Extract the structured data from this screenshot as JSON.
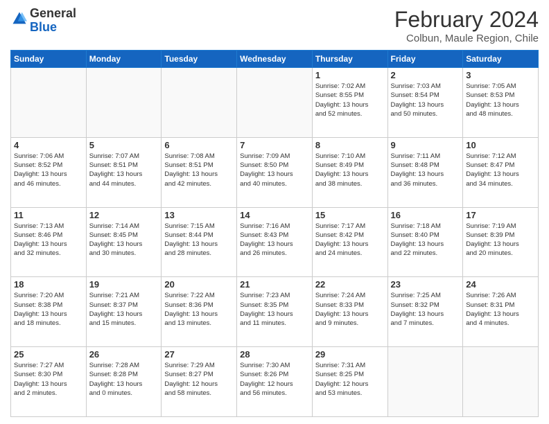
{
  "header": {
    "logo": {
      "line1": "General",
      "line2": "Blue"
    },
    "title": "February 2024",
    "subtitle": "Colbun, Maule Region, Chile"
  },
  "calendar": {
    "days_of_week": [
      "Sunday",
      "Monday",
      "Tuesday",
      "Wednesday",
      "Thursday",
      "Friday",
      "Saturday"
    ],
    "weeks": [
      [
        {
          "day": "",
          "info": ""
        },
        {
          "day": "",
          "info": ""
        },
        {
          "day": "",
          "info": ""
        },
        {
          "day": "",
          "info": ""
        },
        {
          "day": "1",
          "info": "Sunrise: 7:02 AM\nSunset: 8:55 PM\nDaylight: 13 hours\nand 52 minutes."
        },
        {
          "day": "2",
          "info": "Sunrise: 7:03 AM\nSunset: 8:54 PM\nDaylight: 13 hours\nand 50 minutes."
        },
        {
          "day": "3",
          "info": "Sunrise: 7:05 AM\nSunset: 8:53 PM\nDaylight: 13 hours\nand 48 minutes."
        }
      ],
      [
        {
          "day": "4",
          "info": "Sunrise: 7:06 AM\nSunset: 8:52 PM\nDaylight: 13 hours\nand 46 minutes."
        },
        {
          "day": "5",
          "info": "Sunrise: 7:07 AM\nSunset: 8:51 PM\nDaylight: 13 hours\nand 44 minutes."
        },
        {
          "day": "6",
          "info": "Sunrise: 7:08 AM\nSunset: 8:51 PM\nDaylight: 13 hours\nand 42 minutes."
        },
        {
          "day": "7",
          "info": "Sunrise: 7:09 AM\nSunset: 8:50 PM\nDaylight: 13 hours\nand 40 minutes."
        },
        {
          "day": "8",
          "info": "Sunrise: 7:10 AM\nSunset: 8:49 PM\nDaylight: 13 hours\nand 38 minutes."
        },
        {
          "day": "9",
          "info": "Sunrise: 7:11 AM\nSunset: 8:48 PM\nDaylight: 13 hours\nand 36 minutes."
        },
        {
          "day": "10",
          "info": "Sunrise: 7:12 AM\nSunset: 8:47 PM\nDaylight: 13 hours\nand 34 minutes."
        }
      ],
      [
        {
          "day": "11",
          "info": "Sunrise: 7:13 AM\nSunset: 8:46 PM\nDaylight: 13 hours\nand 32 minutes."
        },
        {
          "day": "12",
          "info": "Sunrise: 7:14 AM\nSunset: 8:45 PM\nDaylight: 13 hours\nand 30 minutes."
        },
        {
          "day": "13",
          "info": "Sunrise: 7:15 AM\nSunset: 8:44 PM\nDaylight: 13 hours\nand 28 minutes."
        },
        {
          "day": "14",
          "info": "Sunrise: 7:16 AM\nSunset: 8:43 PM\nDaylight: 13 hours\nand 26 minutes."
        },
        {
          "day": "15",
          "info": "Sunrise: 7:17 AM\nSunset: 8:42 PM\nDaylight: 13 hours\nand 24 minutes."
        },
        {
          "day": "16",
          "info": "Sunrise: 7:18 AM\nSunset: 8:40 PM\nDaylight: 13 hours\nand 22 minutes."
        },
        {
          "day": "17",
          "info": "Sunrise: 7:19 AM\nSunset: 8:39 PM\nDaylight: 13 hours\nand 20 minutes."
        }
      ],
      [
        {
          "day": "18",
          "info": "Sunrise: 7:20 AM\nSunset: 8:38 PM\nDaylight: 13 hours\nand 18 minutes."
        },
        {
          "day": "19",
          "info": "Sunrise: 7:21 AM\nSunset: 8:37 PM\nDaylight: 13 hours\nand 15 minutes."
        },
        {
          "day": "20",
          "info": "Sunrise: 7:22 AM\nSunset: 8:36 PM\nDaylight: 13 hours\nand 13 minutes."
        },
        {
          "day": "21",
          "info": "Sunrise: 7:23 AM\nSunset: 8:35 PM\nDaylight: 13 hours\nand 11 minutes."
        },
        {
          "day": "22",
          "info": "Sunrise: 7:24 AM\nSunset: 8:33 PM\nDaylight: 13 hours\nand 9 minutes."
        },
        {
          "day": "23",
          "info": "Sunrise: 7:25 AM\nSunset: 8:32 PM\nDaylight: 13 hours\nand 7 minutes."
        },
        {
          "day": "24",
          "info": "Sunrise: 7:26 AM\nSunset: 8:31 PM\nDaylight: 13 hours\nand 4 minutes."
        }
      ],
      [
        {
          "day": "25",
          "info": "Sunrise: 7:27 AM\nSunset: 8:30 PM\nDaylight: 13 hours\nand 2 minutes."
        },
        {
          "day": "26",
          "info": "Sunrise: 7:28 AM\nSunset: 8:28 PM\nDaylight: 13 hours\nand 0 minutes."
        },
        {
          "day": "27",
          "info": "Sunrise: 7:29 AM\nSunset: 8:27 PM\nDaylight: 12 hours\nand 58 minutes."
        },
        {
          "day": "28",
          "info": "Sunrise: 7:30 AM\nSunset: 8:26 PM\nDaylight: 12 hours\nand 56 minutes."
        },
        {
          "day": "29",
          "info": "Sunrise: 7:31 AM\nSunset: 8:25 PM\nDaylight: 12 hours\nand 53 minutes."
        },
        {
          "day": "",
          "info": ""
        },
        {
          "day": "",
          "info": ""
        }
      ]
    ]
  }
}
